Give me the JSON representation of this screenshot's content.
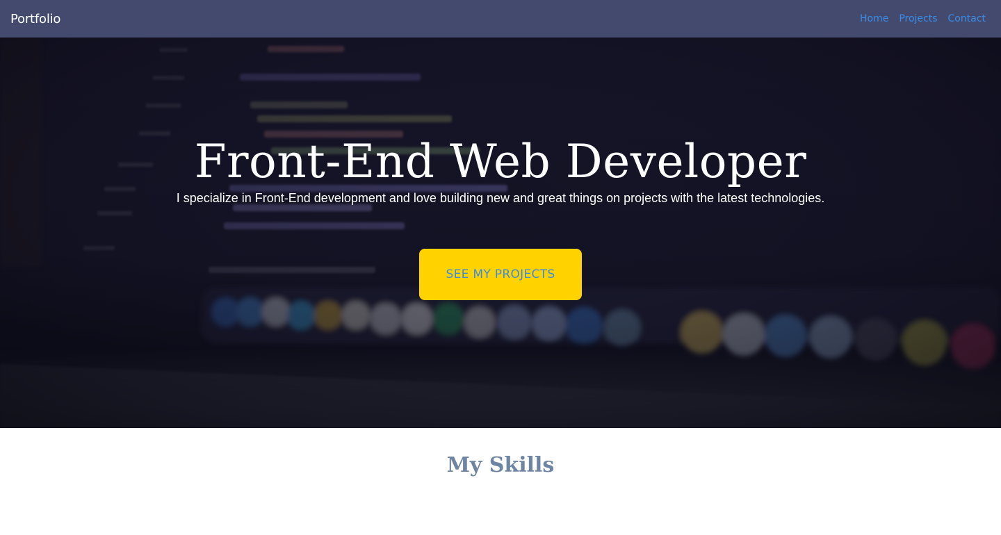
{
  "navbar": {
    "brand": "Portfolio",
    "links": [
      "Home",
      "Projects",
      "Contact"
    ]
  },
  "hero": {
    "title": "Front-End Web Developer",
    "subtitle": "I specialize in Front-End development and love building new and great things on projects with the latest technologies.",
    "cta_label": "SEE MY PROJECTS"
  },
  "skills": {
    "title": "My Skills"
  },
  "colors": {
    "navbar_bg": "#434a6e",
    "link": "#3b8ce6",
    "cta_bg": "#ffd200",
    "skills_title": "#6e84a3"
  }
}
